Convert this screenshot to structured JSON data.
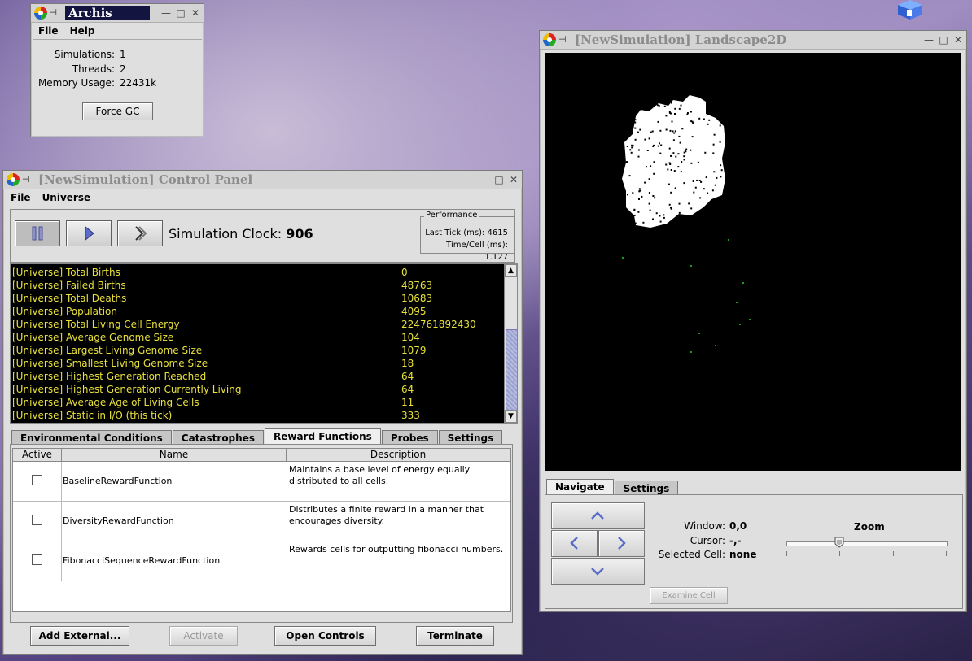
{
  "desktop": {
    "icon_name": "cube-icon"
  },
  "archis": {
    "title": "Archis",
    "menu": [
      "File",
      "Help"
    ],
    "stats": [
      {
        "label": "Simulations:",
        "value": "1"
      },
      {
        "label": "Threads:",
        "value": "2"
      },
      {
        "label": "Memory Usage:",
        "value": "22431k"
      }
    ],
    "force_gc": "Force GC"
  },
  "control_panel": {
    "title": "[NewSimulation] Control Panel",
    "menu": [
      "File",
      "Universe"
    ],
    "clock_label": "Simulation Clock:",
    "clock_value": "906",
    "performance": {
      "legend": "Performance",
      "last_tick": "Last Tick (ms): 4615",
      "time_cell": "Time/Cell (ms): 1.127"
    },
    "console_rows": [
      {
        "name": "[Universe] Total Births",
        "value": "0"
      },
      {
        "name": "[Universe] Failed Births",
        "value": "48763"
      },
      {
        "name": "[Universe] Total Deaths",
        "value": "10683"
      },
      {
        "name": "[Universe] Population",
        "value": "4095"
      },
      {
        "name": "[Universe] Total Living Cell Energy",
        "value": "224761892430"
      },
      {
        "name": "[Universe] Average Genome Size",
        "value": "104"
      },
      {
        "name": "[Universe] Largest Living Genome Size",
        "value": "1079"
      },
      {
        "name": "[Universe] Smallest Living Genome Size",
        "value": "18"
      },
      {
        "name": "[Universe] Highest Generation Reached",
        "value": "64"
      },
      {
        "name": "[Universe] Highest Generation Currently Living",
        "value": "64"
      },
      {
        "name": "[Universe] Average Age of Living Cells",
        "value": "11"
      },
      {
        "name": "[Universe] Static in I/O (this tick)",
        "value": "333"
      }
    ],
    "tabs": [
      "Environmental Conditions",
      "Catastrophes",
      "Reward Functions",
      "Probes",
      "Settings"
    ],
    "selected_tab": "Reward Functions",
    "table_headers": [
      "Active",
      "Name",
      "Description"
    ],
    "table_rows": [
      {
        "name": "BaselineRewardFunction",
        "description": "Maintains a base level of energy equally distributed to all cells."
      },
      {
        "name": "DiversityRewardFunction",
        "description": "Distributes a finite reward in a manner that encourages diversity."
      },
      {
        "name": "FibonacciSequenceRewardFunction",
        "description": "Rewards cells for outputting fibonacci numbers."
      }
    ],
    "buttons": {
      "add_external": "Add External...",
      "activate": "Activate",
      "open_controls": "Open Controls",
      "terminate": "Terminate"
    }
  },
  "landscape": {
    "title": "[NewSimulation] Landscape2D",
    "tabs": [
      "Navigate",
      "Settings"
    ],
    "window_label": "Window:",
    "window_value": "0,0",
    "cursor_label": "Cursor:",
    "cursor_value": "-,-",
    "selected_label": "Selected Cell:",
    "selected_value": "none",
    "zoom_label": "Zoom",
    "zoom_level": 0.33,
    "examine": "Examine Cell"
  }
}
